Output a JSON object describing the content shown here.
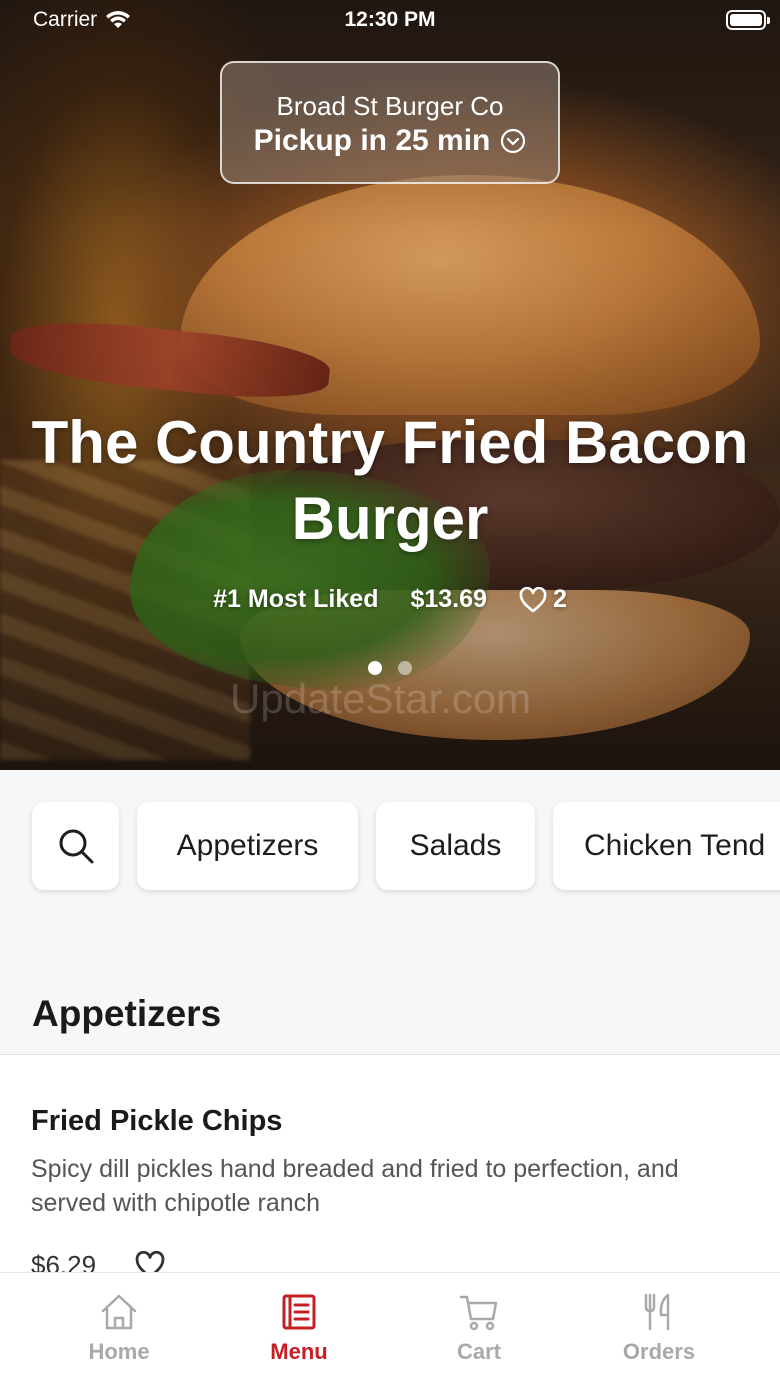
{
  "status_bar": {
    "carrier": "Carrier",
    "time": "12:30 PM"
  },
  "pickup": {
    "store_name": "Broad St Burger Co",
    "pickup_time": "Pickup in 25 min"
  },
  "hero": {
    "title": "The Country Fried Bacon Burger",
    "badge": "#1 Most Liked",
    "price": "$13.69",
    "likes": "2",
    "slides_total": 2,
    "slide_active": 1,
    "watermark": "UpdateStar.com"
  },
  "categories": [
    "Appetizers",
    "Salads",
    "Chicken Tend"
  ],
  "section": {
    "title": "Appetizers",
    "items": [
      {
        "name": "Fried Pickle Chips",
        "description": "Spicy dill pickles hand breaded and fried to perfection, and served with chipotle ranch",
        "price": "$6.29"
      }
    ]
  },
  "tabs": [
    {
      "label": "Home",
      "icon": "home-icon",
      "active": false
    },
    {
      "label": "Menu",
      "icon": "menu-icon",
      "active": true
    },
    {
      "label": "Cart",
      "icon": "cart-icon",
      "active": false
    },
    {
      "label": "Orders",
      "icon": "orders-icon",
      "active": false
    }
  ],
  "colors": {
    "accent": "#c51f24",
    "tab_inactive": "#a9a9a9"
  }
}
